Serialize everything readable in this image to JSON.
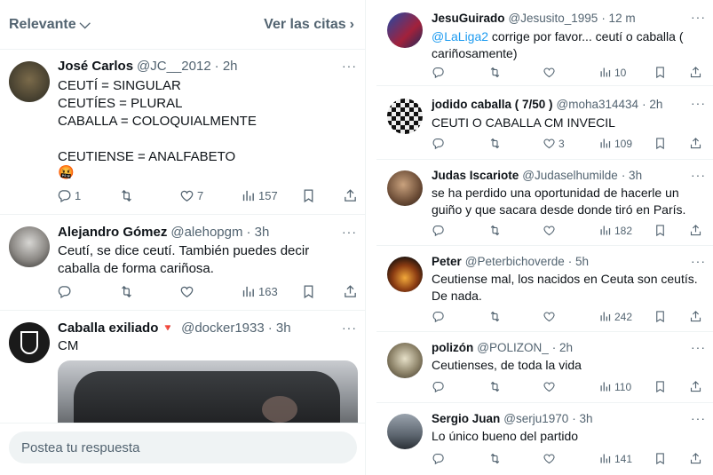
{
  "left": {
    "header": {
      "relevance_label": "Relevante",
      "quotes_label": "Ver las citas"
    },
    "tweets": [
      {
        "name": "José Carlos",
        "handle": "@JC__2012",
        "time": "· 2h",
        "text": "CEUTÍ = SINGULAR\nCEUTÍES = PLURAL\nCABALLA = COLOQUIALMENTE\n\nCEUTIENSE = ANALFABETO",
        "emoji": "🤬",
        "replies": "1",
        "likes": "7",
        "views": "157"
      },
      {
        "name": "Alejandro Gómez",
        "handle": "@alehopgm",
        "time": "· 3h",
        "text": "Ceutí, se dice ceutí. También puedes decir caballa de forma cariñosa.",
        "views": "163"
      },
      {
        "name": "Caballa exiliado",
        "flag": "🔻",
        "handle": "@docker1933",
        "time": "· 3h",
        "text": "CM"
      }
    ],
    "reply_placeholder": "Postea tu respuesta"
  },
  "right": {
    "tweets": [
      {
        "name": "JesuGuirado",
        "handle": "@Jesusito_1995",
        "time": "· 12 m",
        "mention": "@LaLiga2",
        "text": " corrige por favor... ceutí o caballa ( cariñosamente)",
        "views": "10"
      },
      {
        "name": "jodido caballa ( 7/50 )",
        "handle": "@moha314434",
        "time": "· 2h",
        "text": "CEUTI O CABALLA CM INVECIL",
        "likes": "3",
        "views": "109"
      },
      {
        "name": "Judas Iscariote",
        "handle": "@Judaselhumilde",
        "time": "· 3h",
        "text": "se ha perdido una oportunidad de hacerle un guiño y que sacara desde donde tiró en París.",
        "views": "182"
      },
      {
        "name": "Peter",
        "handle": "@Peterbichoverde",
        "time": "· 5h",
        "text": "Ceutiense mal, los nacidos en Ceuta son ceutís. De nada.",
        "views": "242"
      },
      {
        "name": "polizón",
        "handle": "@POLIZON_",
        "time": "· 2h",
        "text": "Ceutienses, de toda la vida",
        "views": "110"
      },
      {
        "name": "Sergio Juan",
        "handle": "@serju1970",
        "time": "· 3h",
        "text": "Lo único bueno del partido",
        "views": "141"
      }
    ]
  },
  "icons": {
    "more": "more-dots-icon",
    "reply": "reply-icon",
    "retweet": "retweet-icon",
    "like": "heart-icon",
    "views": "views-icon",
    "bookmark": "bookmark-icon",
    "share": "share-icon"
  }
}
